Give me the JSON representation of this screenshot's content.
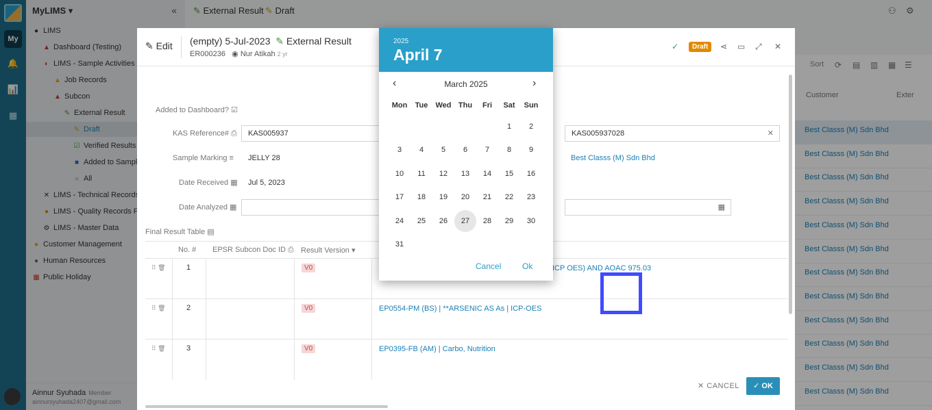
{
  "app": {
    "name": "MyLIMS",
    "rail_my": "My",
    "collapse_glyph": "«"
  },
  "sidebar": {
    "items": [
      {
        "label": "LIMS",
        "icon": "globe-icon"
      },
      {
        "label": "Dashboard (Testing)",
        "icon": "flask-icon"
      },
      {
        "label": "LIMS - Sample Activities",
        "icon": "cycle-icon"
      },
      {
        "label": "Job Records",
        "icon": "warning-icon"
      },
      {
        "label": "Subcon",
        "icon": "flask-icon"
      },
      {
        "label": "External Result",
        "icon": "pencil-icon"
      },
      {
        "label": "Draft",
        "icon": "memo-icon"
      },
      {
        "label": "Verified Results",
        "icon": "check-box-icon"
      },
      {
        "label": "Added to Sample",
        "icon": "blue-square-icon"
      },
      {
        "label": "All",
        "icon": "ring-icon"
      },
      {
        "label": "LIMS - Technical Records F",
        "icon": "tools-icon"
      },
      {
        "label": "LIMS - Quality Records For",
        "icon": "medal-icon"
      },
      {
        "label": "LIMS - Master Data",
        "icon": "gear-icon"
      },
      {
        "label": "Customer Management",
        "icon": "face-icon"
      },
      {
        "label": "Human Resources",
        "icon": "people-icon"
      },
      {
        "label": "Public Holiday",
        "icon": "calendar-icon"
      }
    ],
    "user": {
      "name": "Ainnur Syuhada",
      "role": "Member",
      "email": "ainnursyuhada2407@gmail.com"
    }
  },
  "topbar": {
    "crumb1": "External Result",
    "crumb2": "Draft"
  },
  "list": {
    "sort_label": "Sort",
    "col_customer": "Customer",
    "col_external": "Exter",
    "rows": [
      "Best Classs (M) Sdn Bhd",
      "Best Classs (M) Sdn Bhd",
      "Best Classs (M) Sdn Bhd",
      "Best Classs (M) Sdn Bhd",
      "Best Classs (M) Sdn Bhd",
      "Best Classs (M) Sdn Bhd",
      "Best Classs (M) Sdn Bhd",
      "Best Classs (M) Sdn Bhd",
      "Best Classs (M) Sdn Bhd",
      "Best Classs (M) Sdn Bhd",
      "Best Classs (M) Sdn Bhd",
      "Best Classs (M) Sdn Bhd"
    ]
  },
  "dialog": {
    "edit_label": "Edit",
    "title": "(empty) 5-Jul-2023",
    "title_type": "External Result",
    "record_id": "ER000236",
    "author": "Nur Atikah",
    "ago": "2 yr",
    "status": "Draft",
    "fields": {
      "added_to_dashboard": "Added to Dashboard?",
      "kas_ref_label": "KAS Reference#",
      "kas_ref_value": "KAS005937",
      "kas_ref_right": "KAS005937028",
      "sample_marking_label": "Sample Marking",
      "sample_marking_value": "JELLY 28",
      "customer_link": "Best Classs (M) Sdn Bhd",
      "date_received_label": "Date Received",
      "date_received_value": "Jul 5, 2023",
      "date_analyzed_label": "Date Analyzed"
    },
    "table": {
      "title": "Final Result Table",
      "col_no": "No.",
      "col_doc": "EPSR Subcon Doc ID",
      "col_version": "Result Version",
      "rows": [
        {
          "no": "1",
          "version": "V0",
          "test": "ICP OES) AND AOAC 975.03"
        },
        {
          "no": "2",
          "version": "V0",
          "test": "EP0554-PM (BS) | **ARSENIC AS As | ICP-OES"
        },
        {
          "no": "3",
          "version": "V0",
          "test": "EP0395-FB (AM) | Carbo, Nutrition"
        }
      ]
    },
    "cancel": "CANCEL",
    "ok": "OK"
  },
  "picker": {
    "year": "2025",
    "selected_date": "April 7",
    "month_label": "March 2025",
    "weekdays": [
      "Mon",
      "Tue",
      "Wed",
      "Thu",
      "Fri",
      "Sat",
      "Sun"
    ],
    "first_weekday_index": 5,
    "days_in_month": 31,
    "highlighted_day": 27,
    "cancel": "Cancel",
    "ok": "Ok"
  },
  "colors": {
    "rail": "#1f6f8b",
    "picker_header": "#2a9fc9",
    "draft_badge": "#e08a00",
    "link": "#1a7fb5",
    "focus_box": "#3f4bff"
  }
}
